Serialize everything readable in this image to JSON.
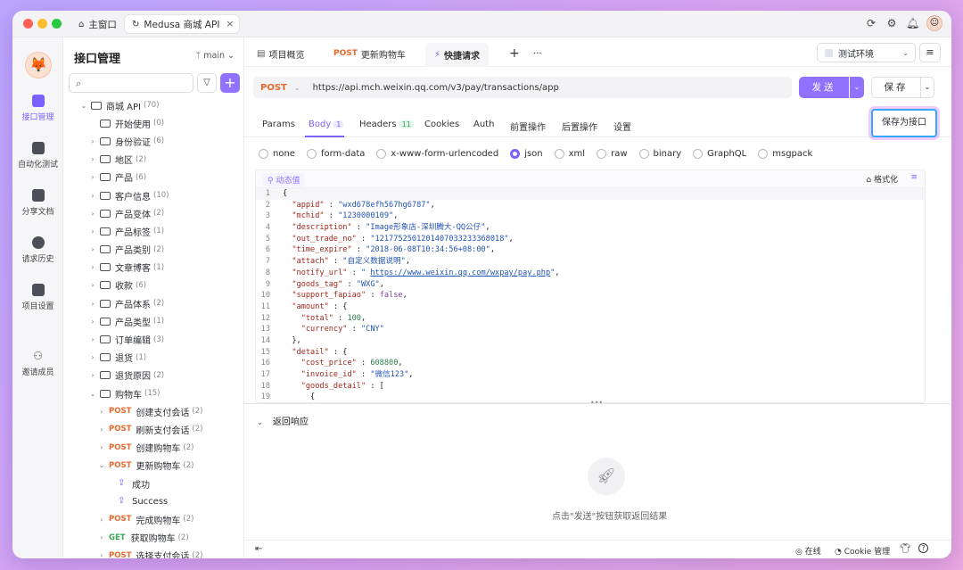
{
  "window": {
    "tabs": [
      {
        "label": "主窗口"
      },
      {
        "label": "Medusa 商城 API"
      }
    ],
    "close_symbol": "×"
  },
  "rail": {
    "items": [
      {
        "label": "接口管理",
        "active": true
      },
      {
        "label": "自动化测试"
      },
      {
        "label": "分享文档"
      },
      {
        "label": "请求历史"
      },
      {
        "label": "项目设置"
      },
      {
        "label": "邀请成员"
      }
    ]
  },
  "sidebar": {
    "title": "接口管理",
    "branch": "main",
    "tree": [
      {
        "indent": 0,
        "chevron": "⌄",
        "type": "folder",
        "label": "商城 API",
        "count": "(70)"
      },
      {
        "indent": 1,
        "chevron": "",
        "type": "folder",
        "label": "开始使用",
        "count": "(0)"
      },
      {
        "indent": 1,
        "chevron": "›",
        "type": "folder",
        "label": "身份验证",
        "count": "(6)"
      },
      {
        "indent": 1,
        "chevron": "›",
        "type": "folder",
        "label": "地区",
        "count": "(2)"
      },
      {
        "indent": 1,
        "chevron": "›",
        "type": "folder",
        "label": "产品",
        "count": "(6)"
      },
      {
        "indent": 1,
        "chevron": "›",
        "type": "folder",
        "label": "客户信息",
        "count": "(10)"
      },
      {
        "indent": 1,
        "chevron": "›",
        "type": "folder",
        "label": "产品变体",
        "count": "(2)"
      },
      {
        "indent": 1,
        "chevron": "›",
        "type": "folder",
        "label": "产品标签",
        "count": "(1)"
      },
      {
        "indent": 1,
        "chevron": "›",
        "type": "folder",
        "label": "产品类别",
        "count": "(2)"
      },
      {
        "indent": 1,
        "chevron": "›",
        "type": "folder",
        "label": "文章博客",
        "count": "(1)"
      },
      {
        "indent": 1,
        "chevron": "›",
        "type": "folder",
        "label": "收款",
        "count": "(6)"
      },
      {
        "indent": 1,
        "chevron": "›",
        "type": "folder",
        "label": "产品体系",
        "count": "(2)"
      },
      {
        "indent": 1,
        "chevron": "›",
        "type": "folder",
        "label": "产品类型",
        "count": "(1)"
      },
      {
        "indent": 1,
        "chevron": "›",
        "type": "folder",
        "label": "订单编辑",
        "count": "(3)"
      },
      {
        "indent": 1,
        "chevron": "›",
        "type": "folder",
        "label": "退货",
        "count": "(1)"
      },
      {
        "indent": 1,
        "chevron": "›",
        "type": "folder",
        "label": "退货原因",
        "count": "(2)"
      },
      {
        "indent": 1,
        "chevron": "⌄",
        "type": "folder",
        "label": "购物车",
        "count": "(15)"
      },
      {
        "indent": 2,
        "chevron": "›",
        "type": "post",
        "method": "POST",
        "label": "创建支付会话",
        "count": "(2)"
      },
      {
        "indent": 2,
        "chevron": "›",
        "type": "post",
        "method": "POST",
        "label": "刷新支付会话",
        "count": "(2)"
      },
      {
        "indent": 2,
        "chevron": "›",
        "type": "post",
        "method": "POST",
        "label": "创建购物车",
        "count": "(2)"
      },
      {
        "indent": 2,
        "chevron": "⌄",
        "type": "post",
        "method": "POST",
        "label": "更新购物车",
        "count": "(2)"
      },
      {
        "indent": 3,
        "chevron": "",
        "type": "example",
        "label": "成功",
        "count": ""
      },
      {
        "indent": 3,
        "chevron": "",
        "type": "example",
        "label": "Success",
        "count": ""
      },
      {
        "indent": 2,
        "chevron": "›",
        "type": "post",
        "method": "POST",
        "label": "完成购物车",
        "count": "(2)"
      },
      {
        "indent": 2,
        "chevron": "›",
        "type": "get",
        "method": "GET",
        "label": "获取购物车",
        "count": "(2)"
      },
      {
        "indent": 2,
        "chevron": "›",
        "type": "post",
        "method": "POST",
        "label": "选择支付会话",
        "count": "(2)"
      }
    ]
  },
  "tabs": {
    "overview": "项目概览",
    "update_method": "POST",
    "update_label": "更新购物车",
    "quick_label": "快捷请求",
    "plus": "+",
    "more": "···",
    "env": "测试环境"
  },
  "request": {
    "method": "POST",
    "url": "https://api.mch.weixin.qq.com/v3/pay/transactions/app",
    "send": "发送",
    "save": "保存",
    "save_as": "保存为接口"
  },
  "subtabs": [
    {
      "label": "Params"
    },
    {
      "label": "Body",
      "badge": "1"
    },
    {
      "label": "Headers",
      "badge": "11"
    },
    {
      "label": "Cookies"
    },
    {
      "label": "Auth"
    },
    {
      "label": "前置操作"
    },
    {
      "label": "后置操作"
    },
    {
      "label": "设置"
    }
  ],
  "body_types": [
    "none",
    "form-data",
    "x-www-form-urlencoded",
    "json",
    "xml",
    "raw",
    "binary",
    "GraphQL",
    "msgpack"
  ],
  "selected_body_type": "json",
  "editor": {
    "dynamic_label": "动态值",
    "format_label": "格式化",
    "lines": [
      [
        {
          "c": "t",
          "v": "{"
        }
      ],
      [
        {
          "c": "t",
          "v": "  "
        },
        {
          "c": "k",
          "v": "\"appid\""
        },
        {
          "c": "t",
          "v": " : "
        },
        {
          "c": "s",
          "v": "\"wxd678efh567hg6787\""
        },
        {
          "c": "t",
          "v": ","
        }
      ],
      [
        {
          "c": "t",
          "v": "  "
        },
        {
          "c": "k",
          "v": "\"mchid\""
        },
        {
          "c": "t",
          "v": " : "
        },
        {
          "c": "s",
          "v": "\"1230000109\""
        },
        {
          "c": "t",
          "v": ","
        }
      ],
      [
        {
          "c": "t",
          "v": "  "
        },
        {
          "c": "k",
          "v": "\"description\""
        },
        {
          "c": "t",
          "v": " : "
        },
        {
          "c": "s",
          "v": "\"Image形象店-深圳腾大-QQ公仔\""
        },
        {
          "c": "t",
          "v": ","
        }
      ],
      [
        {
          "c": "t",
          "v": "  "
        },
        {
          "c": "k",
          "v": "\"out_trade_no\""
        },
        {
          "c": "t",
          "v": " : "
        },
        {
          "c": "s",
          "v": "\"1217752501201407033233368018\""
        },
        {
          "c": "t",
          "v": ","
        }
      ],
      [
        {
          "c": "t",
          "v": "  "
        },
        {
          "c": "k",
          "v": "\"time_expire\""
        },
        {
          "c": "t",
          "v": " : "
        },
        {
          "c": "s",
          "v": "\"2018-06-08T10:34:56+08:00\""
        },
        {
          "c": "t",
          "v": ","
        }
      ],
      [
        {
          "c": "t",
          "v": "  "
        },
        {
          "c": "k",
          "v": "\"attach\""
        },
        {
          "c": "t",
          "v": " : "
        },
        {
          "c": "s",
          "v": "\"自定义数据说明\""
        },
        {
          "c": "t",
          "v": ","
        }
      ],
      [
        {
          "c": "t",
          "v": "  "
        },
        {
          "c": "k",
          "v": "\"notify_url\""
        },
        {
          "c": "t",
          "v": " : "
        },
        {
          "c": "s",
          "v": "\" "
        },
        {
          "c": "lnk",
          "v": "https://www.weixin.qq.com/wxpay/pay.php"
        },
        {
          "c": "s",
          "v": "\""
        },
        {
          "c": "t",
          "v": ","
        }
      ],
      [
        {
          "c": "t",
          "v": "  "
        },
        {
          "c": "k",
          "v": "\"goods_tag\""
        },
        {
          "c": "t",
          "v": " : "
        },
        {
          "c": "s",
          "v": "\"WXG\""
        },
        {
          "c": "t",
          "v": ","
        }
      ],
      [
        {
          "c": "t",
          "v": "  "
        },
        {
          "c": "k",
          "v": "\"support_fapiao\""
        },
        {
          "c": "t",
          "v": " : "
        },
        {
          "c": "b",
          "v": "false"
        },
        {
          "c": "t",
          "v": ","
        }
      ],
      [
        {
          "c": "t",
          "v": "  "
        },
        {
          "c": "k",
          "v": "\"amount\""
        },
        {
          "c": "t",
          "v": " : {"
        }
      ],
      [
        {
          "c": "t",
          "v": "    "
        },
        {
          "c": "k",
          "v": "\"total\""
        },
        {
          "c": "t",
          "v": " : "
        },
        {
          "c": "n",
          "v": "100"
        },
        {
          "c": "t",
          "v": ","
        }
      ],
      [
        {
          "c": "t",
          "v": "    "
        },
        {
          "c": "k",
          "v": "\"currency\""
        },
        {
          "c": "t",
          "v": " : "
        },
        {
          "c": "s",
          "v": "\"CNY\""
        }
      ],
      [
        {
          "c": "t",
          "v": "  },"
        }
      ],
      [
        {
          "c": "t",
          "v": "  "
        },
        {
          "c": "k",
          "v": "\"detail\""
        },
        {
          "c": "t",
          "v": " : {"
        }
      ],
      [
        {
          "c": "t",
          "v": "    "
        },
        {
          "c": "k",
          "v": "\"cost_price\""
        },
        {
          "c": "t",
          "v": " : "
        },
        {
          "c": "n",
          "v": "608800"
        },
        {
          "c": "t",
          "v": ","
        }
      ],
      [
        {
          "c": "t",
          "v": "    "
        },
        {
          "c": "k",
          "v": "\"invoice_id\""
        },
        {
          "c": "t",
          "v": " : "
        },
        {
          "c": "s",
          "v": "\"微信123\""
        },
        {
          "c": "t",
          "v": ","
        }
      ],
      [
        {
          "c": "t",
          "v": "    "
        },
        {
          "c": "k",
          "v": "\"goods_detail\""
        },
        {
          "c": "t",
          "v": " : ["
        }
      ],
      [
        {
          "c": "t",
          "v": "      {"
        }
      ]
    ]
  },
  "response": {
    "title": "返回响应",
    "hint": "点击\"发送\"按钮获取返回结果"
  },
  "footer": {
    "online": "在线",
    "cookie": "Cookie 管理"
  },
  "colors": {
    "accent": "#8f72ff",
    "post": "#e8692a",
    "get": "#3aa55a"
  }
}
